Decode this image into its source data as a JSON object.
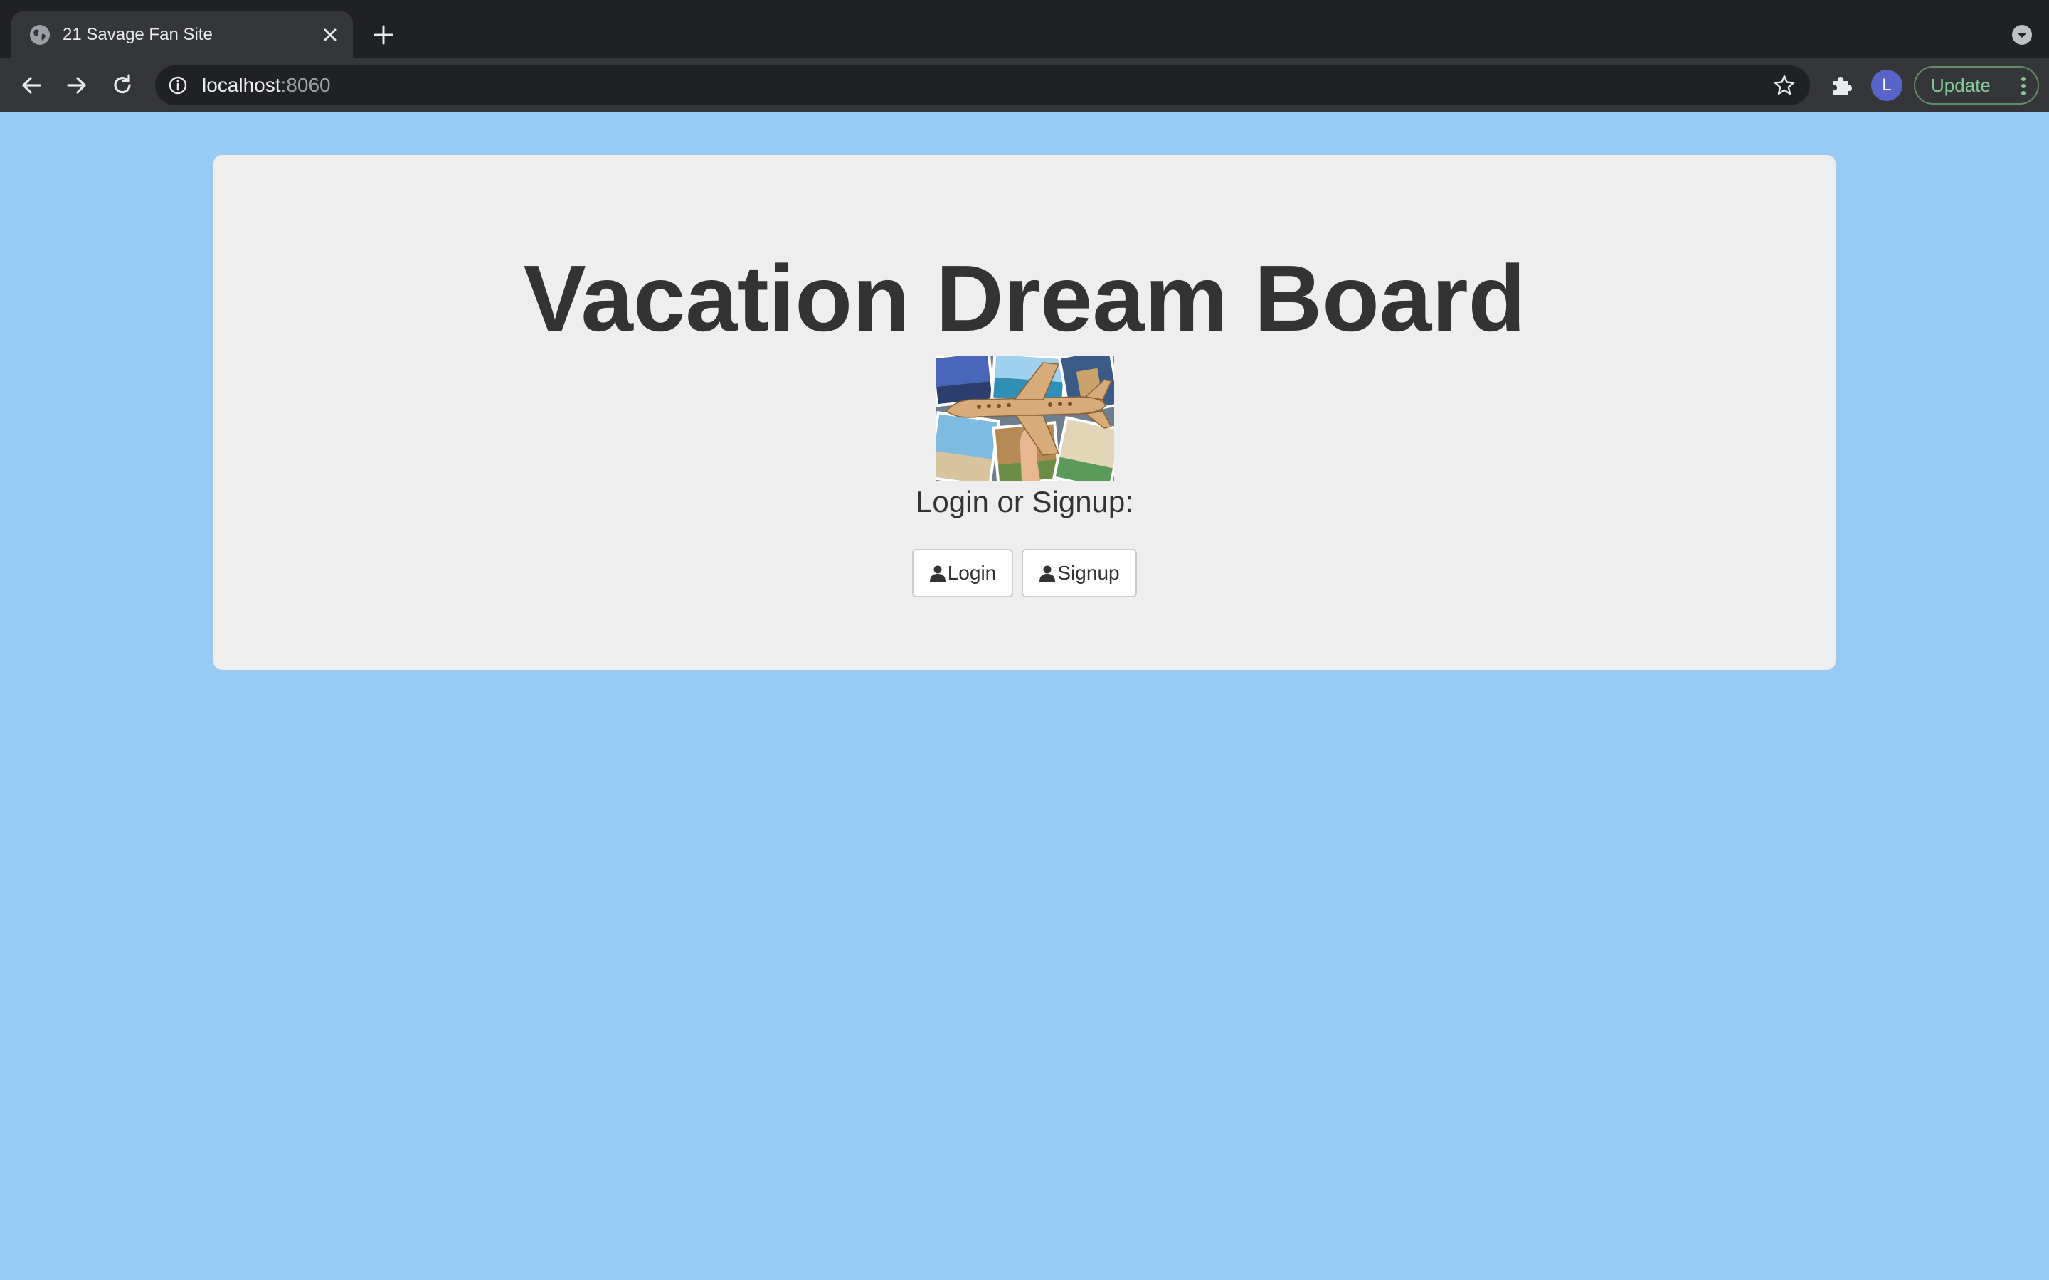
{
  "browser": {
    "tab_title": "21 Savage Fan Site",
    "url_host": "localhost",
    "url_port": ":8060",
    "avatar_letter": "L",
    "update_label": "Update",
    "update_color": "#81c995"
  },
  "page": {
    "background_color": "#98cbf4",
    "panel_color": "#eeeeee",
    "heading": "Vacation Dream Board",
    "subtitle": "Login or Signup:",
    "login_label": "Login",
    "signup_label": "Signup",
    "hero_image": "airplane-photo-collage",
    "button_icon": "user-icon"
  }
}
